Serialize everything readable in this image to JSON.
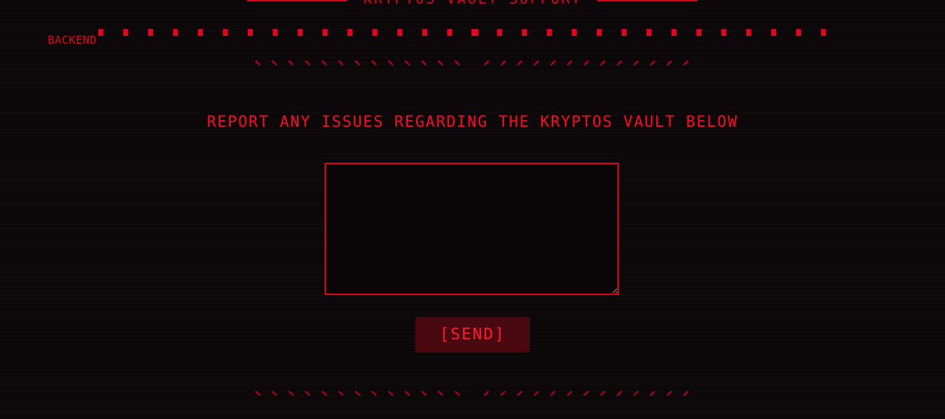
{
  "header": {
    "title": "KRYPTOS VAULT SUPPORT"
  },
  "progress": {
    "label": "BACKEND",
    "dot_count": 30
  },
  "main": {
    "headline": "REPORT ANY ISSUES REGARDING THE KRYPTOS VAULT BELOW",
    "report_field_value": "",
    "send_label": "[SEND]"
  },
  "colors": {
    "background": "#0b0708",
    "accent": "#e8001c",
    "button_background": "#4a0810"
  }
}
